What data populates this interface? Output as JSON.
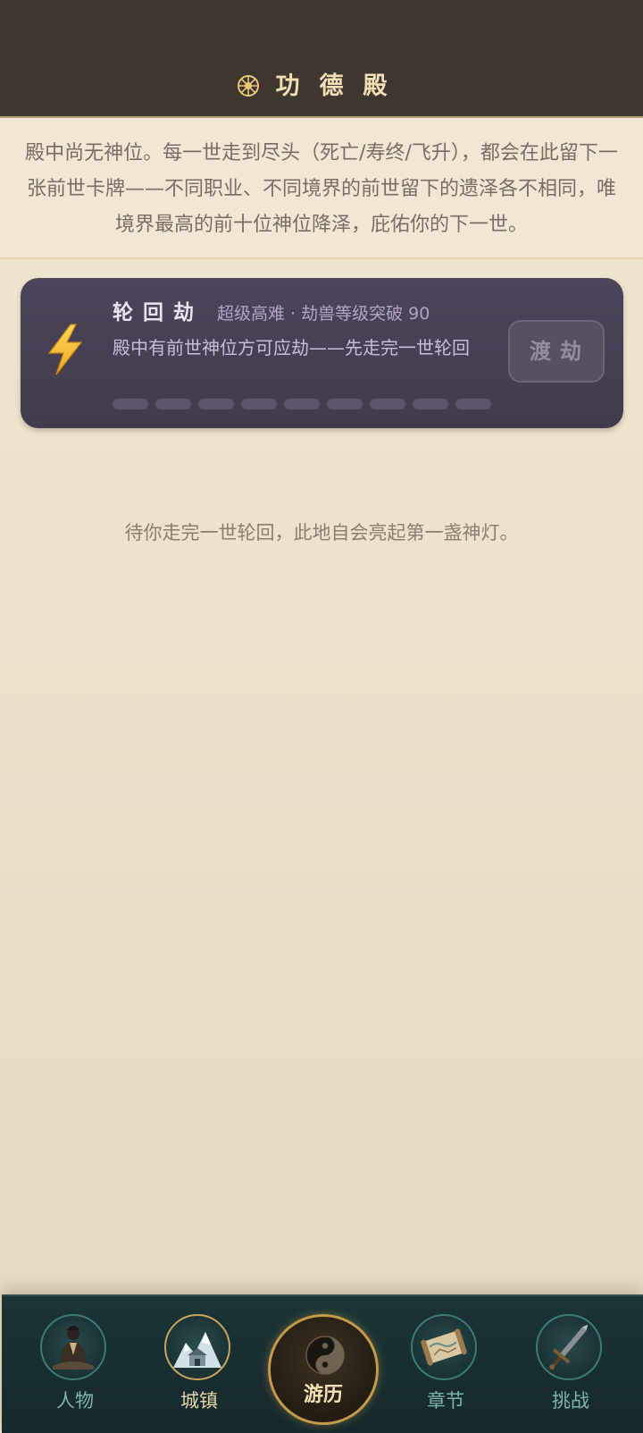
{
  "header": {
    "title": "功德殿",
    "icon": "dharma-wheel-icon",
    "background_color": "#3e3630",
    "title_color": "#f1dfb5"
  },
  "intro": {
    "text": "殿中尚无神位。每一世走到尽头（死亡/寿终/飞升），都会在此留下一张前世卡牌——不同职业、不同境界的前世留下的遗泽各不相同，唯境界最高的前十位神位降泽，庇佑你的下一世。"
  },
  "tribulation": {
    "icon": "lightning-icon",
    "title": "轮回劫",
    "meta": "超级高难 · 劫兽等级突破 90",
    "description": "殿中有前世神位方可应劫——先走完一世轮回",
    "progress_segments": 9,
    "progress_filled": 0,
    "button_label": "渡劫",
    "card_color": "#4a4357"
  },
  "empty_message": "待你走完一世轮回，此地自会亮起第一盏神灯。",
  "bottom_nav": {
    "items": [
      {
        "label": "人物",
        "icon": "character-icon"
      },
      {
        "label": "城镇",
        "icon": "town-icon"
      },
      {
        "label": "游历",
        "icon": "yin-yang-icon",
        "selected": true
      },
      {
        "label": "章节",
        "icon": "scroll-map-icon"
      },
      {
        "label": "挑战",
        "icon": "sword-icon"
      }
    ],
    "background_color": "#1b3436",
    "accent_color": "#c29a48"
  }
}
